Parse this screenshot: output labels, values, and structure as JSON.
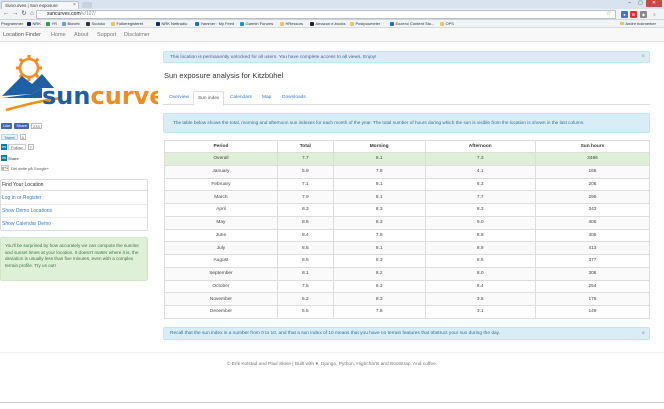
{
  "browser": {
    "tab_title": "Suncurves | Sun exposure",
    "tab_close": "×",
    "window_buttons": [
      "–",
      "▢",
      "✕"
    ],
    "url_host": "suncurves.com",
    "url_path": "/v/107/",
    "bookmarks": [
      "Programmer",
      "NRK",
      "YR",
      "Bloveb",
      "Sudoku",
      "Folkeregisteret",
      "NRK Nettradio",
      "Yammer : My Feed",
      "Garmin Forums",
      "HRessurs",
      "Amazon e-books",
      "Postpoumeler",
      "Eozenc Content Stu...",
      "OPS"
    ],
    "other_bookmarks": "Andre bokmerker"
  },
  "navbar": {
    "brand": "Location Finder",
    "links": [
      "Home",
      "About",
      "Support",
      "Disclaimer"
    ]
  },
  "sidebar": {
    "logo_text": "suncurves",
    "social": {
      "like": "Like",
      "share": "Share",
      "fb_count": "233",
      "tweet": "Tweet",
      "tweet_count": "6",
      "follow": "Follow",
      "follow_count": "7",
      "in_share": "Share",
      "gplus": "Del dette på Google+"
    },
    "finder": {
      "title": "Find Your Location",
      "items": [
        "Log in or Register",
        "Show Demo Locations",
        "Show Calendar Demo"
      ]
    },
    "note": "You'll be surprised by how accurately we can compute the sunrise and sunset times at your location. It doesn't matter where it is, the deviation is usually less than five minutes, even with a complex terrain profile. Try us out!"
  },
  "main": {
    "unlock_alert": "This location is permanently unlocked for all users. You have complete access to all views. Enjoy!",
    "close_symbol": "×",
    "title": "Sun exposure analysis for Kitzbühel",
    "tabs": [
      "Overview",
      "Sun index",
      "Calendars",
      "Map",
      "Downloads"
    ],
    "active_tab": "Sun index",
    "description": "The table below shows the total, morning and afternoon sun indexes for each month of the year. The total number of hours during which the sun is visible from the location is shown in the last column.",
    "table": {
      "headers": [
        "Period",
        "Total",
        "Morning",
        "Afternoon",
        "Sun hours"
      ],
      "rows": [
        [
          "Overall",
          "7.7",
          "8.1",
          "7.3",
          "3496"
        ],
        [
          "January",
          "5.9",
          "7.8",
          "4.1",
          "165"
        ],
        [
          "February",
          "7.1",
          "8.1",
          "6.3",
          "206"
        ],
        [
          "March",
          "7.9",
          "8.1",
          "7.7",
          "295"
        ],
        [
          "April",
          "8.3",
          "8.3",
          "8.3",
          "343"
        ],
        [
          "May",
          "8.6",
          "8.3",
          "9.0",
          "406"
        ],
        [
          "June",
          "8.4",
          "7.9",
          "8.9",
          "405"
        ],
        [
          "July",
          "8.5",
          "8.1",
          "8.9",
          "413"
        ],
        [
          "August",
          "8.5",
          "8.3",
          "8.6",
          "377"
        ],
        [
          "September",
          "8.1",
          "8.2",
          "8.0",
          "306"
        ],
        [
          "October",
          "7.5",
          "8.3",
          "6.4",
          "254"
        ],
        [
          "November",
          "6.2",
          "8.3",
          "3.5",
          "175"
        ],
        [
          "December",
          "5.5",
          "7.8",
          "3.1",
          "149"
        ]
      ]
    },
    "footer_note": "Recall that the sun index is a number from 0 to 10, and that a sun index of 10 means that you have no terrain features that obstruct your sun during the day."
  },
  "footer": {
    "text": "© Erik Kolstad and Paul Skeie | Built with ♥, Django, Python, Highcharts and Bootstrap. And coffee."
  },
  "colors": {
    "brand_blue": "#1f5fa3",
    "brand_orange": "#f28c1e",
    "link": "#3a7bbf",
    "info_bg": "#d9edf7",
    "success_bg": "#dff0d8"
  }
}
